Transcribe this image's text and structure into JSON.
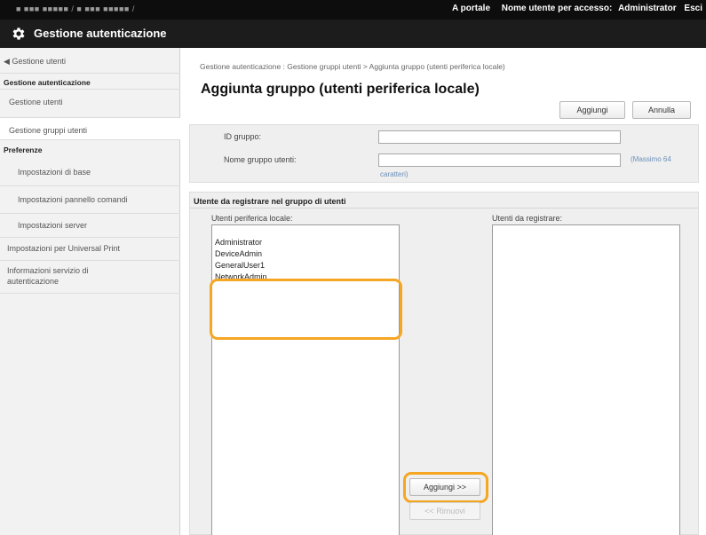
{
  "topbar": {
    "host": "■ ■■■ ■■■■■ / ■ ■■■ ■■■■■ /",
    "portal_link": "A portale",
    "user_label": "Nome utente per accesso:",
    "user_value": "Administrator",
    "logout_label": "Esci"
  },
  "titlebar": {
    "title": "Gestione autenticazione"
  },
  "sidebar": {
    "back": "Gestione utenti",
    "section_auth": "Gestione autenticazione",
    "users": "Gestione utenti",
    "groups": "Gestione gruppi utenti",
    "section_prefs": "Preferenze",
    "basic": "Impostazioni di base",
    "panel": "Impostazioni pannello comandi",
    "server": "Impostazioni server",
    "universal": "Impostazioni per Universal Print",
    "info_line1": "Informazioni servizio di",
    "info_line2": "autenticazione"
  },
  "main": {
    "breadcrumb": "Gestione autenticazione : Gestione gruppi utenti > Aggiunta gruppo (utenti periferica locale)",
    "title": "Aggiunta gruppo (utenti periferica locale)",
    "add_button": "Aggiungi",
    "cancel_button": "Annulla",
    "group_id_label": "ID gruppo:",
    "group_name_label": "Nome gruppo utenti:",
    "group_id_value": "",
    "group_name_value": "",
    "hint_part1": "(Massimo 64",
    "hint_part2": "caratteri)"
  },
  "members": {
    "section_title": "Utente da registrare nel gruppo di utenti",
    "local_label": "Utenti periferica locale:",
    "register_label": "Utenti da registrare:",
    "local_users": [
      "Administrator",
      "DeviceAdmin",
      "GeneralUser1",
      "NetworkAdmin"
    ],
    "add_button": "Aggiungi >>",
    "remove_button": "<< Rimuovi"
  },
  "colors": {
    "highlight": "#f5a623",
    "header_bg": "#0d0d0d",
    "title_bg": "#1c1c1c",
    "hint": "#6a8fb8"
  }
}
